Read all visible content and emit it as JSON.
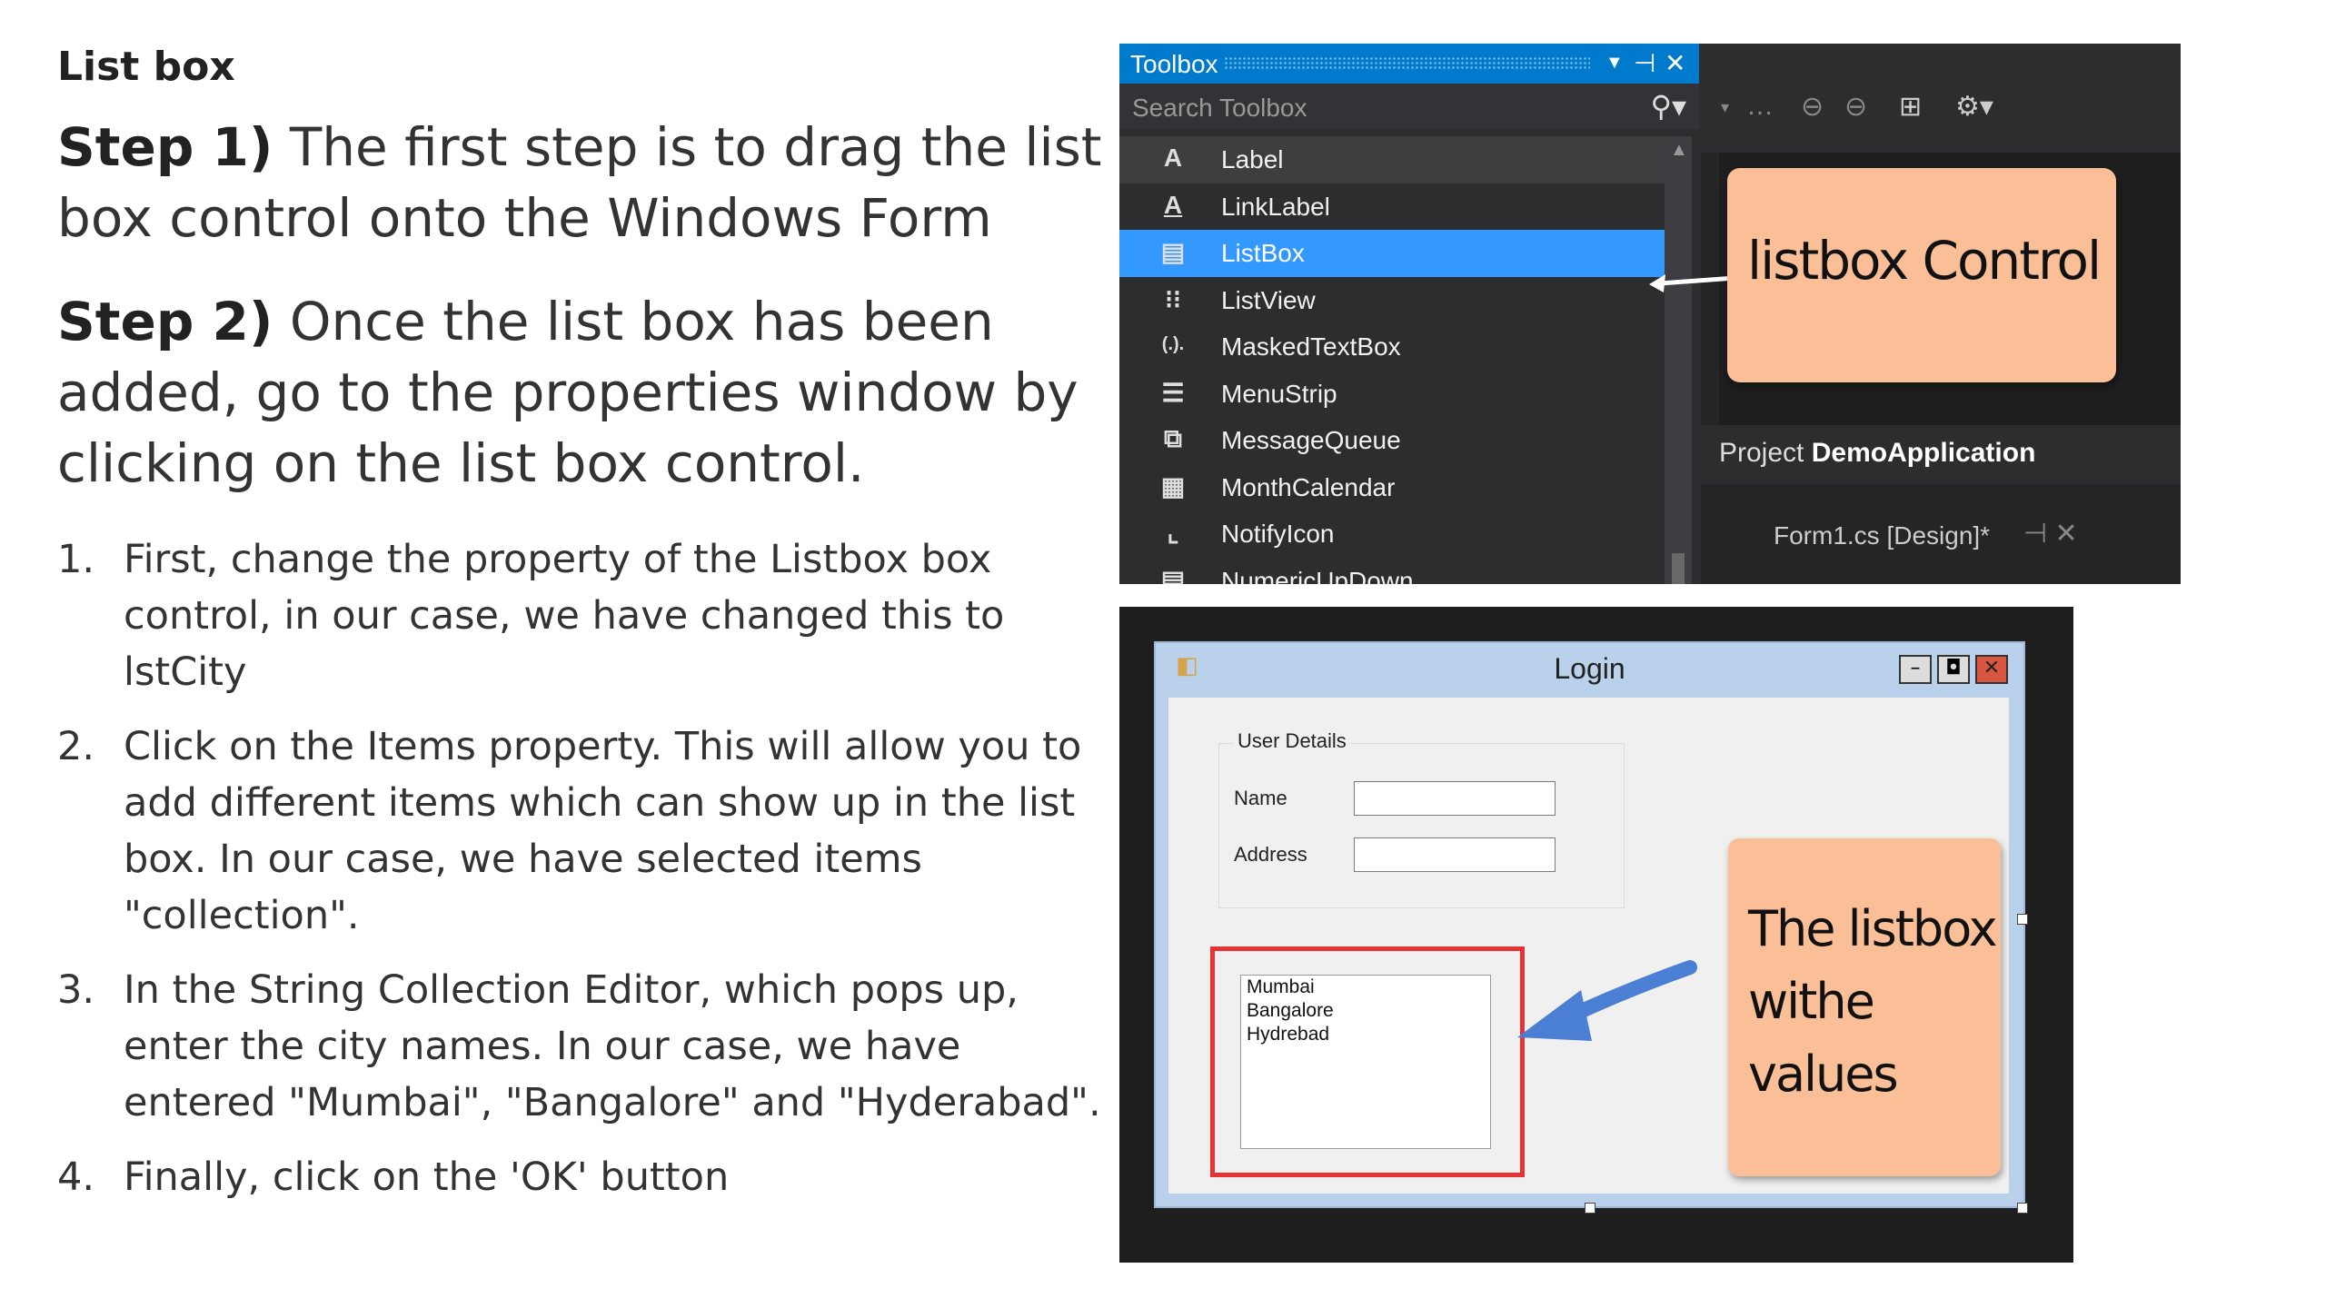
{
  "left": {
    "heading": "List box",
    "step1_label": "Step 1)",
    "step1_text": " The first step is to drag the list box control onto the Windows Form",
    "step2_label": "Step 2)",
    "step2_text": " Once the list box has been added, go to the properties window by clicking on the list box control.",
    "items": [
      {
        "num": "1.",
        "text": "First, change the property of the Listbox box control, in our case, we have changed this to lstCity"
      },
      {
        "num": "2.",
        "text": "Click on the Items property. This will allow you to add different items which can show up in the list box. In our case, we have selected items \"collection\"."
      },
      {
        "num": "3.",
        "text": "In the String Collection Editor, which pops up, enter the city names. In our case, we have entered \"Mumbai\", \"Bangalore\" and \"Hyderabad\"."
      },
      {
        "num": "4.",
        "text": "Finally, click on the 'OK' button"
      }
    ]
  },
  "toolbox": {
    "title": "Toolbox",
    "search_placeholder": "Search Toolbox",
    "items": [
      {
        "icon": "A",
        "label": "Label"
      },
      {
        "icon": "A",
        "label": "LinkLabel"
      },
      {
        "icon": "▤",
        "label": "ListBox"
      },
      {
        "icon": "⁝⁝",
        "label": "ListView"
      },
      {
        "icon": "(.).",
        "label": "MaskedTextBox"
      },
      {
        "icon": "☰",
        "label": "MenuStrip"
      },
      {
        "icon": "⧉",
        "label": "MessageQueue"
      },
      {
        "icon": "▦",
        "label": "MonthCalendar"
      },
      {
        "icon": "⌞",
        "label": "NotifyIcon"
      },
      {
        "icon": "▤",
        "label": "NumericUpDown"
      }
    ],
    "project_prefix": "Project ",
    "project_name": "DemoApplication",
    "tab_label": "Form1.cs [Design]*",
    "callout": "listbox Control"
  },
  "form": {
    "title": "Login",
    "group_label": "User Details",
    "name_label": "Name",
    "address_label": "Address",
    "listbox_items": [
      "Mumbai",
      "Bangalore",
      "Hydrebad"
    ],
    "callout_lines": [
      "The listbox",
      "withe",
      "values"
    ]
  },
  "colors": {
    "accent_blue": "#007acc",
    "selection_blue": "#3399ff",
    "note": "#fbbf98",
    "highlight_red": "#e63434"
  }
}
